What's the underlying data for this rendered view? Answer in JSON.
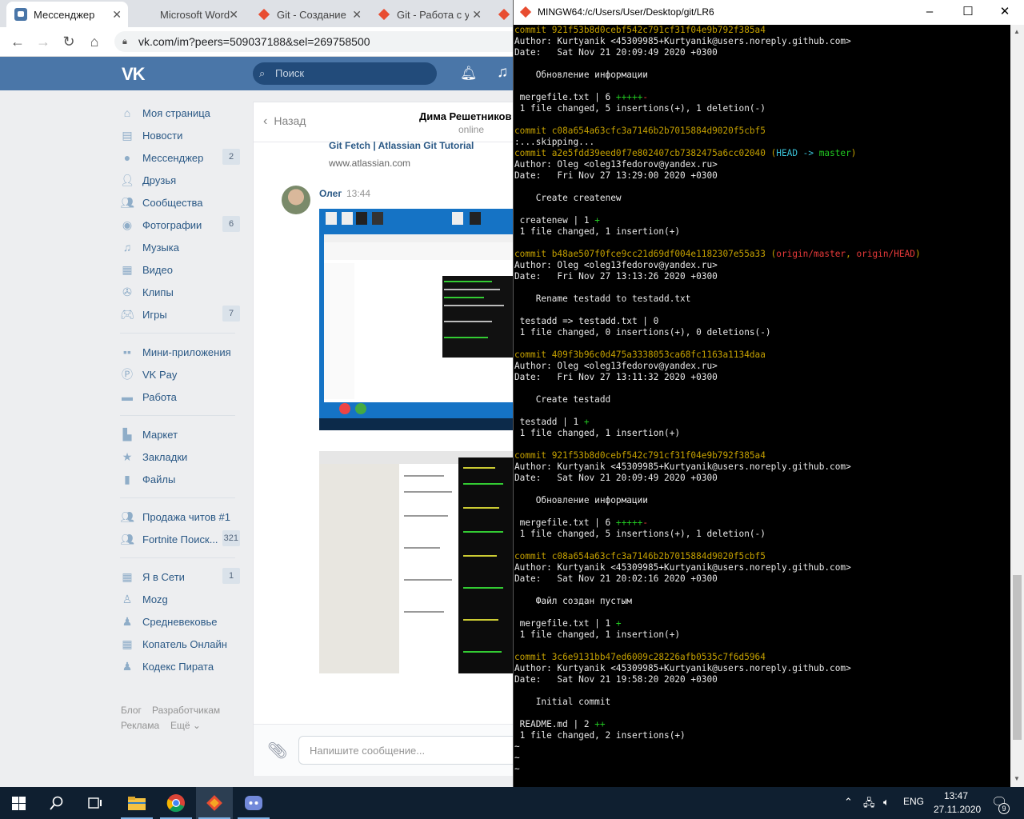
{
  "browser": {
    "tabs": [
      {
        "label": "Мессенджер",
        "icon": "vk-messenger-icon",
        "active": true
      },
      {
        "label": "Microsoft Word",
        "icon": "word-icon",
        "active": false
      },
      {
        "label": "Git - Создание",
        "icon": "git-icon",
        "active": false
      },
      {
        "label": "Git - Работа с у",
        "icon": "git-icon",
        "active": false
      },
      {
        "label": "",
        "icon": "git-icon",
        "active": false
      }
    ],
    "url": "vk.com/im?peers=509037188&sel=269758500"
  },
  "vk": {
    "search_placeholder": "Поиск",
    "logo": "VK",
    "sidebar": [
      {
        "label": "Моя страница",
        "icon": "home-icon",
        "count": ""
      },
      {
        "label": "Новости",
        "icon": "news-icon",
        "count": ""
      },
      {
        "label": "Мессенджер",
        "icon": "messenger-icon",
        "count": "2"
      },
      {
        "label": "Друзья",
        "icon": "friends-icon",
        "count": ""
      },
      {
        "label": "Сообщества",
        "icon": "communities-icon",
        "count": ""
      },
      {
        "label": "Фотографии",
        "icon": "camera-icon",
        "count": "6"
      },
      {
        "label": "Музыка",
        "icon": "music-icon",
        "count": ""
      },
      {
        "label": "Видео",
        "icon": "video-icon",
        "count": ""
      },
      {
        "label": "Клипы",
        "icon": "clips-icon",
        "count": ""
      },
      {
        "label": "Игры",
        "icon": "games-icon",
        "count": "7"
      },
      {
        "label": "Мини-приложения",
        "icon": "mini-apps-icon",
        "count": ""
      },
      {
        "label": "VK Pay",
        "icon": "vkpay-icon",
        "count": ""
      },
      {
        "label": "Работа",
        "icon": "briefcase-icon",
        "count": ""
      },
      {
        "label": "Маркет",
        "icon": "market-icon",
        "count": ""
      },
      {
        "label": "Закладки",
        "icon": "star-icon",
        "count": ""
      },
      {
        "label": "Файлы",
        "icon": "file-icon",
        "count": ""
      },
      {
        "label": "Продажа читов #1",
        "icon": "group-icon",
        "count": ""
      },
      {
        "label": "Fortnite Поиск...",
        "icon": "group-icon",
        "count": "321"
      },
      {
        "label": "Я в Сети",
        "icon": "app-icon",
        "count": "1"
      },
      {
        "label": "Mozg",
        "icon": "app-icon",
        "count": ""
      },
      {
        "label": "Средневековье",
        "icon": "app-icon",
        "count": ""
      },
      {
        "label": "Копатель Онлайн",
        "icon": "app-icon",
        "count": ""
      },
      {
        "label": "Кодекс Пирата",
        "icon": "app-icon",
        "count": ""
      }
    ],
    "footer": {
      "blog": "Блог",
      "dev": "Разработчикам",
      "ads": "Реклама",
      "more": "Ещё ⌄"
    },
    "chat": {
      "back": "Назад",
      "name": "Дима Решетников",
      "status": "online",
      "link_title": "Git Fetch | Atlassian Git Tutorial",
      "link_url": "www.atlassian.com",
      "sender": "Олег",
      "time": "13:44",
      "composer_placeholder": "Напишите сообщение..."
    }
  },
  "terminal": {
    "title": "MINGW64:/c/Users/User/Desktop/git/LR6",
    "lines": [
      [
        {
          "t": "commit 921f53b8d0cebf542c791cf31f04e9b792f385a4",
          "c": "y"
        }
      ],
      [
        {
          "t": "Author: Kurtyanik <45309985+Kurtyanik@users.noreply.github.com>"
        }
      ],
      [
        {
          "t": "Date:   Sat Nov 21 20:09:49 2020 +0300"
        }
      ],
      [
        {
          "t": ""
        }
      ],
      [
        {
          "t": "    Обновление информации"
        }
      ],
      [
        {
          "t": ""
        }
      ],
      [
        {
          "t": " mergefile.txt | 6 "
        },
        {
          "t": "+++++",
          "c": "g"
        },
        {
          "t": "-",
          "c": "r"
        }
      ],
      [
        {
          "t": " 1 file changed, 5 insertions(+), 1 deletion(-)"
        }
      ],
      [
        {
          "t": ""
        }
      ],
      [
        {
          "t": "commit c08a654a63cfc3a7146b2b7015884d9020f5cbf5",
          "c": "y"
        }
      ],
      [
        {
          "t": ":...skipping..."
        }
      ],
      [
        {
          "t": "commit a2e5fdd39eed0f7e802407cb7382475a6cc02040 ",
          "c": "y"
        },
        {
          "t": "(",
          "c": "y"
        },
        {
          "t": "HEAD -> ",
          "c": "c"
        },
        {
          "t": "master",
          "c": "g"
        },
        {
          "t": ")",
          "c": "y"
        }
      ],
      [
        {
          "t": "Author: Oleg <oleg13fedorov@yandex.ru>"
        }
      ],
      [
        {
          "t": "Date:   Fri Nov 27 13:29:00 2020 +0300"
        }
      ],
      [
        {
          "t": ""
        }
      ],
      [
        {
          "t": "    Create createnew"
        }
      ],
      [
        {
          "t": ""
        }
      ],
      [
        {
          "t": " createnew | 1 "
        },
        {
          "t": "+",
          "c": "g"
        }
      ],
      [
        {
          "t": " 1 file changed, 1 insertion(+)"
        }
      ],
      [
        {
          "t": ""
        }
      ],
      [
        {
          "t": "commit b48ae507f0fce9cc21d69df004e1182307e55a33 ",
          "c": "y"
        },
        {
          "t": "(",
          "c": "y"
        },
        {
          "t": "origin/master",
          "c": "r"
        },
        {
          "t": ", ",
          "c": "y"
        },
        {
          "t": "origin/HEAD",
          "c": "r"
        },
        {
          "t": ")",
          "c": "y"
        }
      ],
      [
        {
          "t": "Author: Oleg <oleg13fedorov@yandex.ru>"
        }
      ],
      [
        {
          "t": "Date:   Fri Nov 27 13:13:26 2020 +0300"
        }
      ],
      [
        {
          "t": ""
        }
      ],
      [
        {
          "t": "    Rename testadd to testadd.txt"
        }
      ],
      [
        {
          "t": ""
        }
      ],
      [
        {
          "t": " testadd => testadd.txt | 0"
        }
      ],
      [
        {
          "t": " 1 file changed, 0 insertions(+), 0 deletions(-)"
        }
      ],
      [
        {
          "t": ""
        }
      ],
      [
        {
          "t": "commit 409f3b96c0d475a3338053ca68fc1163a1134daa",
          "c": "y"
        }
      ],
      [
        {
          "t": "Author: Oleg <oleg13fedorov@yandex.ru>"
        }
      ],
      [
        {
          "t": "Date:   Fri Nov 27 13:11:32 2020 +0300"
        }
      ],
      [
        {
          "t": ""
        }
      ],
      [
        {
          "t": "    Create testadd"
        }
      ],
      [
        {
          "t": ""
        }
      ],
      [
        {
          "t": " testadd | 1 "
        },
        {
          "t": "+",
          "c": "g"
        }
      ],
      [
        {
          "t": " 1 file changed, 1 insertion(+)"
        }
      ],
      [
        {
          "t": ""
        }
      ],
      [
        {
          "t": "commit 921f53b8d0cebf542c791cf31f04e9b792f385a4",
          "c": "y"
        }
      ],
      [
        {
          "t": "Author: Kurtyanik <45309985+Kurtyanik@users.noreply.github.com>"
        }
      ],
      [
        {
          "t": "Date:   Sat Nov 21 20:09:49 2020 +0300"
        }
      ],
      [
        {
          "t": ""
        }
      ],
      [
        {
          "t": "    Обновление информации"
        }
      ],
      [
        {
          "t": ""
        }
      ],
      [
        {
          "t": " mergefile.txt | 6 "
        },
        {
          "t": "+++++",
          "c": "g"
        },
        {
          "t": "-",
          "c": "r"
        }
      ],
      [
        {
          "t": " 1 file changed, 5 insertions(+), 1 deletion(-)"
        }
      ],
      [
        {
          "t": ""
        }
      ],
      [
        {
          "t": "commit c08a654a63cfc3a7146b2b7015884d9020f5cbf5",
          "c": "y"
        }
      ],
      [
        {
          "t": "Author: Kurtyanik <45309985+Kurtyanik@users.noreply.github.com>"
        }
      ],
      [
        {
          "t": "Date:   Sat Nov 21 20:02:16 2020 +0300"
        }
      ],
      [
        {
          "t": ""
        }
      ],
      [
        {
          "t": "    Файл создан пустым"
        }
      ],
      [
        {
          "t": ""
        }
      ],
      [
        {
          "t": " mergefile.txt | 1 "
        },
        {
          "t": "+",
          "c": "g"
        }
      ],
      [
        {
          "t": " 1 file changed, 1 insertion(+)"
        }
      ],
      [
        {
          "t": ""
        }
      ],
      [
        {
          "t": "commit 3c6e9131bb47ed6009c28226afb0535c7f6d5964",
          "c": "y"
        }
      ],
      [
        {
          "t": "Author: Kurtyanik <45309985+Kurtyanik@users.noreply.github.com>"
        }
      ],
      [
        {
          "t": "Date:   Sat Nov 21 19:58:20 2020 +0300"
        }
      ],
      [
        {
          "t": ""
        }
      ],
      [
        {
          "t": "    Initial commit"
        }
      ],
      [
        {
          "t": ""
        }
      ],
      [
        {
          "t": " README.md | 2 "
        },
        {
          "t": "++",
          "c": "g"
        }
      ],
      [
        {
          "t": " 1 file changed, 2 insertions(+)"
        }
      ],
      [
        {
          "t": "~"
        }
      ],
      [
        {
          "t": "~"
        }
      ],
      [
        {
          "t": "~"
        }
      ]
    ]
  },
  "taskbar": {
    "lang": "ENG",
    "time": "13:47",
    "date": "27.11.2020",
    "notifications": "9",
    "apps": [
      "start-icon",
      "search-icon",
      "task-view-icon",
      "file-explorer-icon",
      "chrome-icon",
      "git-bash-icon",
      "discord-icon"
    ]
  },
  "colors": {
    "vk_blue": "#4a76a8",
    "vk_link": "#2a5885",
    "terminal_bg": "#000000",
    "git_yellow": "#c4a000",
    "git_green": "#21c721",
    "git_red": "#e83a3a",
    "git_cyan": "#3ac2d8",
    "taskbar_bg": "#0f1f30"
  }
}
